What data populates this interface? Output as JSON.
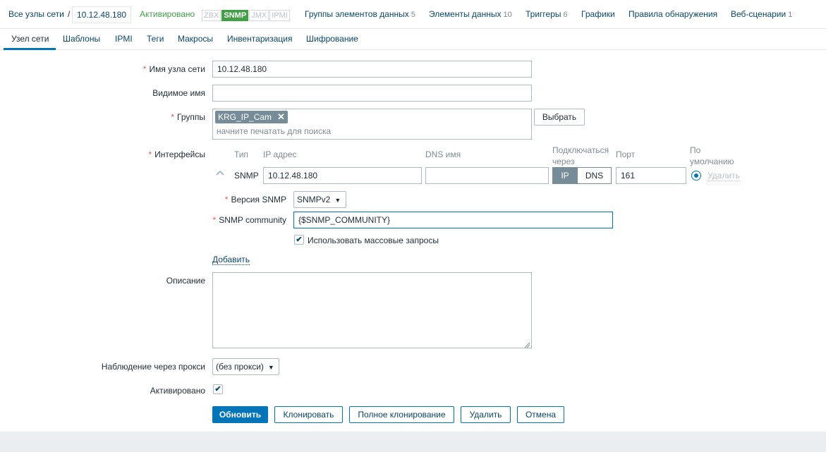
{
  "breadcrumb": {
    "all_hosts": "Все узлы сети",
    "separator": "/",
    "host": "10.12.48.180",
    "status": "Активировано"
  },
  "availability": [
    "ZBX",
    "SNMP",
    "JMX",
    "IPMI"
  ],
  "host_nav": {
    "item_groups": {
      "label": "Группы элементов данных",
      "count": "5"
    },
    "items": {
      "label": "Элементы данных",
      "count": "10"
    },
    "triggers": {
      "label": "Триггеры",
      "count": "6"
    },
    "graphs": {
      "label": "Графики"
    },
    "discovery": {
      "label": "Правила обнаружения"
    },
    "web": {
      "label": "Веб-сценарии",
      "count": "1"
    }
  },
  "tabs": [
    "Узел сети",
    "Шаблоны",
    "IPMI",
    "Теги",
    "Макросы",
    "Инвентаризация",
    "Шифрование"
  ],
  "form": {
    "host_name": {
      "label": "Имя узла сети",
      "value": "10.12.48.180"
    },
    "visible_name": {
      "label": "Видимое имя",
      "value": ""
    },
    "groups": {
      "label": "Группы",
      "tag": "KRG_IP_Cam",
      "placeholder": "начните печатать для поиска",
      "select_button": "Выбрать"
    },
    "interfaces": {
      "label": "Интерфейсы",
      "headers": {
        "type": "Тип",
        "ip": "IP адрес",
        "dns": "DNS имя",
        "connect_via_1": "Подключаться",
        "connect_via_2": "через",
        "port": "Порт",
        "default_1": "По",
        "default_2": "умолчанию"
      },
      "row": {
        "type": "SNMP",
        "ip": "10.12.48.180",
        "dns": "",
        "connect_ip": "IP",
        "connect_dns": "DNS",
        "port": "161",
        "remove": "Удалить"
      },
      "snmp_version": {
        "label": "Версия SNMP",
        "value": "SNMPv2"
      },
      "snmp_community": {
        "label": "SNMP community",
        "value": "{$SNMP_COMMUNITY}"
      },
      "bulk": {
        "label": "Использовать массовые запросы",
        "checked": true
      },
      "add_link": "Добавить"
    },
    "description": {
      "label": "Описание",
      "value": ""
    },
    "proxy": {
      "label": "Наблюдение через прокси",
      "value": "(без прокси)"
    },
    "enabled": {
      "label": "Активировано",
      "checked": true
    },
    "buttons": {
      "update": "Обновить",
      "clone": "Клонировать",
      "full_clone": "Полное клонирование",
      "delete": "Удалить",
      "cancel": "Отмена"
    }
  },
  "colors": {
    "accent": "#0275b8",
    "link": "#0a466a",
    "enabled_green": "#429e47",
    "required_red": "#e45959"
  }
}
